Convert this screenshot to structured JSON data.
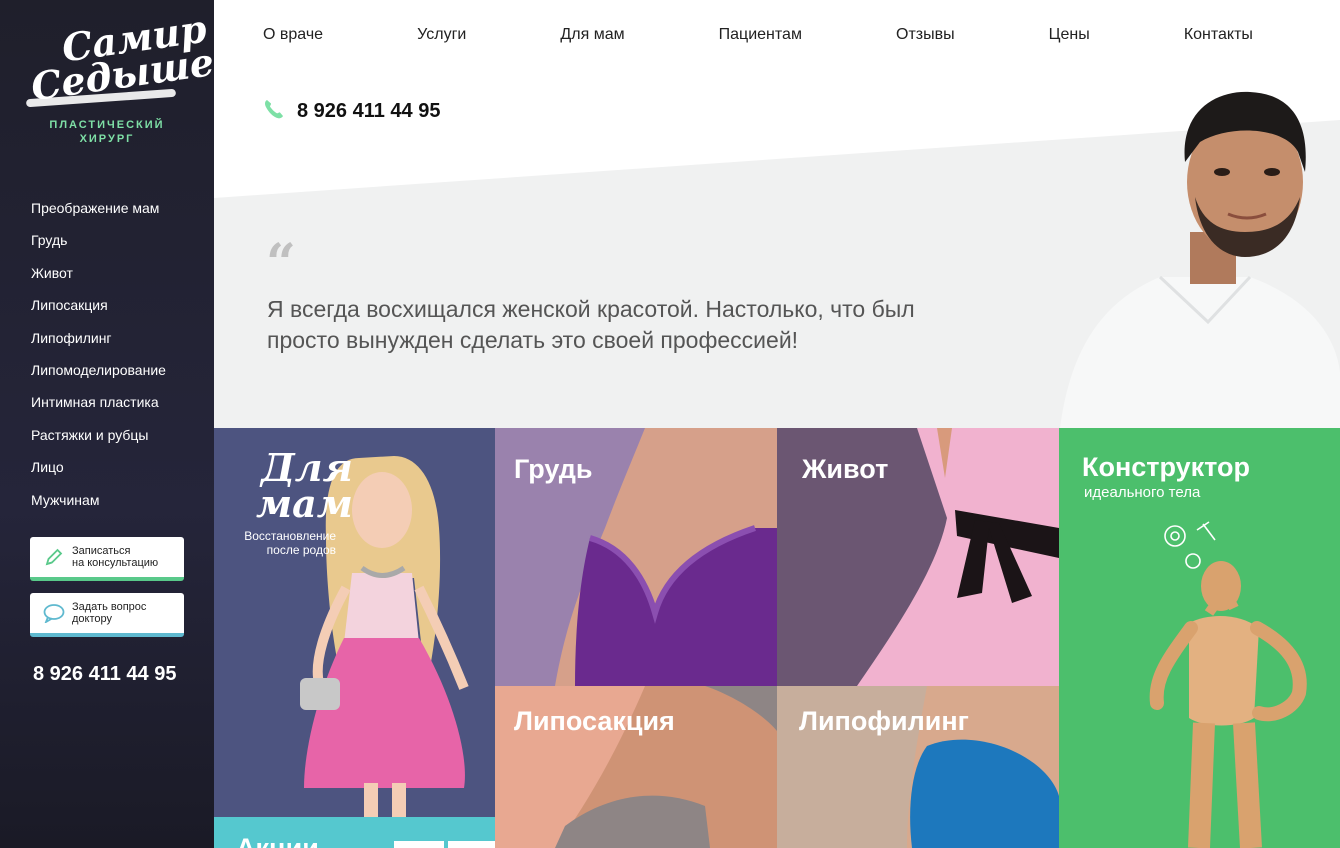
{
  "brand": {
    "logo_line1": "Самир",
    "logo_line2": "Седышев",
    "subtitle_line1": "ПЛАСТИЧЕСКИЙ",
    "subtitle_line2": "ХИРУРГ"
  },
  "sidebar": {
    "items": [
      {
        "label": "Преображение мам"
      },
      {
        "label": "Грудь"
      },
      {
        "label": "Живот"
      },
      {
        "label": "Липосакция"
      },
      {
        "label": "Липофилинг"
      },
      {
        "label": "Липомоделирование"
      },
      {
        "label": "Интимная пластика"
      },
      {
        "label": "Растяжки и рубцы"
      },
      {
        "label": "Лицо"
      },
      {
        "label": "Мужчинам"
      }
    ],
    "cta_book_line1": "Записаться",
    "cta_book_line2": "на консультацию",
    "cta_ask_line1": "Задать вопрос",
    "cta_ask_line2": "доктору",
    "phone": "8 926 411 44 95"
  },
  "topnav": {
    "items": [
      {
        "label": "О враче"
      },
      {
        "label": "Услуги"
      },
      {
        "label": "Для мам"
      },
      {
        "label": "Пациентам"
      },
      {
        "label": "Отзывы"
      },
      {
        "label": "Цены"
      },
      {
        "label": "Контакты"
      }
    ],
    "phone": "8 926 411 44 95"
  },
  "quote": {
    "mark": "“",
    "text": "Я всегда восхищался женской красотой. Настолько, что был просто вынужден сделать это своей профессией!"
  },
  "tiles": {
    "mam_title_line1": "Для",
    "mam_title_line2": "мам",
    "mam_sub": "Восстановление после родов",
    "grud": "Грудь",
    "zhivot": "Живот",
    "konstr": "Конструктор",
    "konstr_sub": "идеального тела",
    "lipos": "Липосакция",
    "lipof": "Липофилинг",
    "akcii": "Акции"
  },
  "colors": {
    "accent_green": "#59c98a",
    "accent_blue": "#5fb9cf",
    "sidebar_bg": "#1f1f2b"
  }
}
